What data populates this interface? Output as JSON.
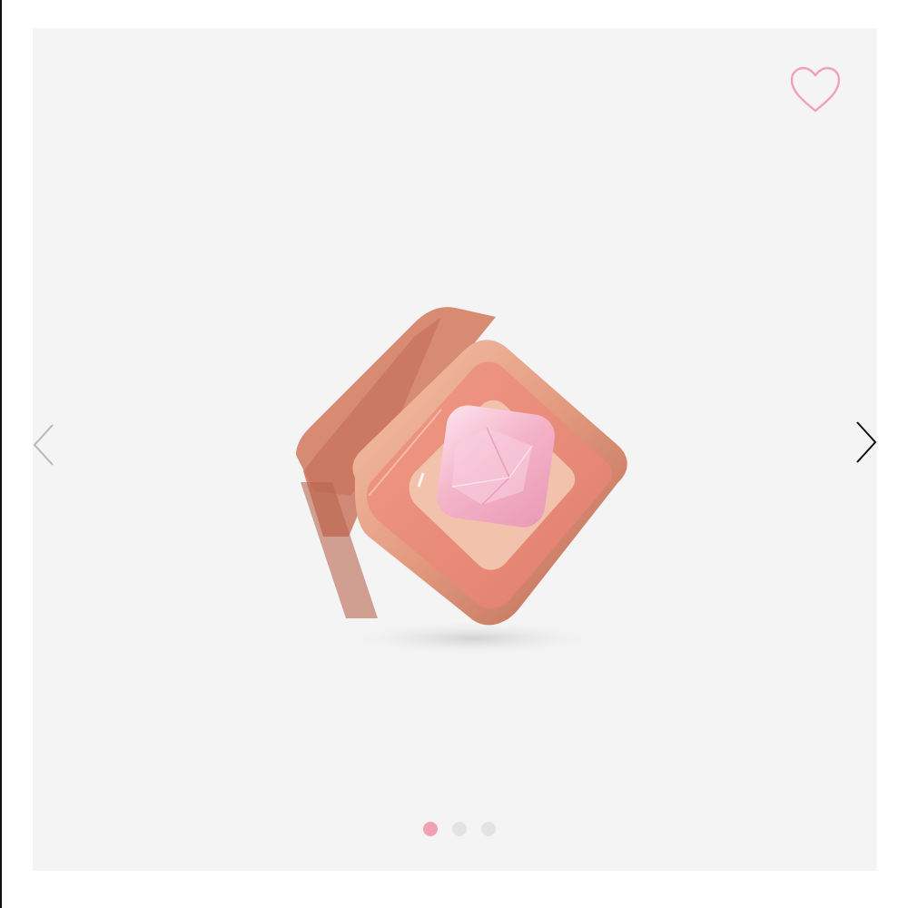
{
  "gallery": {
    "image_icon": "product-charm-image",
    "favorite_icon": "heart-icon",
    "prev_icon": "chevron-left-icon",
    "next_icon": "chevron-right-icon",
    "slides_total": 3,
    "active_slide": 1,
    "colors": {
      "background": "#f4f4f4",
      "heart": "#f0a2b4",
      "dot_active": "#f0a2b4",
      "dot_inactive": "#e3e3e3",
      "rose_gold": "#e9a48a",
      "enamel": "#ec8e7c",
      "stone": "#f6b8cc"
    }
  }
}
